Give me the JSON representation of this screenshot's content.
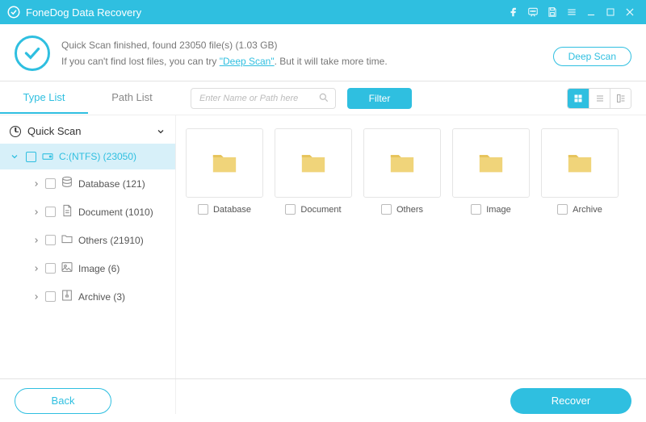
{
  "titlebar": {
    "app_name": "FoneDog Data Recovery"
  },
  "status": {
    "line1_prefix": "Quick Scan finished, found ",
    "file_count": "23050",
    "line1_middle": " file(s) (",
    "size": "1.03 GB",
    "line1_suffix": ")",
    "line2_prefix": "If you can't find lost files, you can try ",
    "deep_scan_link": "\"Deep Scan\"",
    "line2_suffix": ". But it will take more time.",
    "deep_scan_btn": "Deep Scan"
  },
  "tabs": {
    "type_list": "Type List",
    "path_list": "Path List"
  },
  "search": {
    "placeholder": "Enter Name or Path here"
  },
  "filter_btn": "Filter",
  "tree": {
    "root_label": "Quick Scan",
    "drive_label": "C:(NTFS) (23050)",
    "items": [
      {
        "label": "Database (121)",
        "icon": "database"
      },
      {
        "label": "Document (1010)",
        "icon": "document"
      },
      {
        "label": "Others (21910)",
        "icon": "others"
      },
      {
        "label": "Image (6)",
        "icon": "image"
      },
      {
        "label": "Archive (3)",
        "icon": "archive"
      }
    ]
  },
  "folders": [
    {
      "label": "Database"
    },
    {
      "label": "Document"
    },
    {
      "label": "Others"
    },
    {
      "label": "Image"
    },
    {
      "label": "Archive"
    }
  ],
  "footer": {
    "back": "Back",
    "recover": "Recover"
  }
}
